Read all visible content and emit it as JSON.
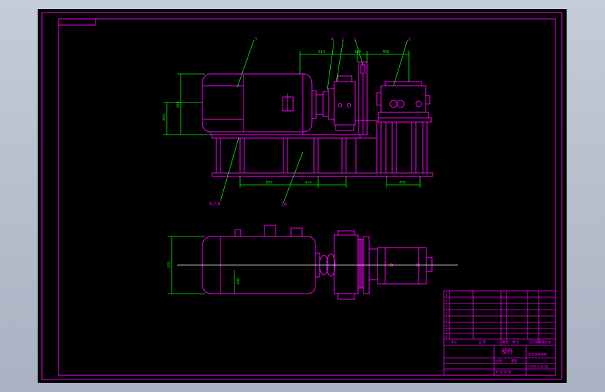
{
  "colors": {
    "background": "#000000",
    "frame": "#ff00ff",
    "dimension": "#00ff00",
    "centerline": "#ffffff",
    "title_text": "#ff00ff"
  },
  "part_callouts": [
    "5",
    "4",
    "1",
    "3",
    "2",
    "6,7,8",
    "10"
  ],
  "dimension_values": {
    "top_1": "514",
    "top_2": "115",
    "top_3": "456",
    "left_1": "398",
    "left_2": "450",
    "bottom_1": "650",
    "bottom_2": "410",
    "bottom_3": "456",
    "plan_1": "270",
    "plan_2": "440"
  },
  "title_block": {
    "rows": [
      "1",
      "2",
      "3",
      "4",
      "5",
      "6",
      "7",
      "8"
    ],
    "header_qty": "数量",
    "header_seq": "序号",
    "header_name": "名 称",
    "header_material": "材 料",
    "part_label": "部件",
    "assembly_name": "热轧钢卷捆带",
    "project": "万方铸铁辊机组",
    "drawing_no": "RHXB-1a8-88",
    "ratio_label": "比例",
    "weight_label": "重量",
    "footer": "共 张 第 张"
  }
}
